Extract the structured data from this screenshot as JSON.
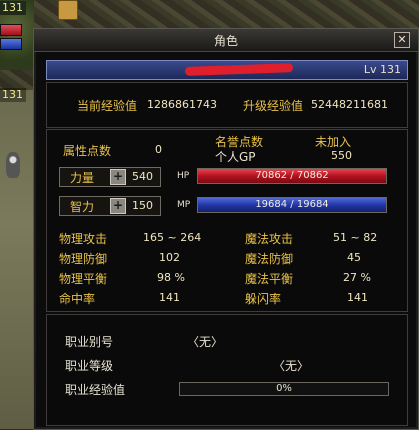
{
  "hud": {
    "top_number": "131",
    "side_number": "131"
  },
  "window": {
    "title": "角色",
    "close_glyph": "✕"
  },
  "character": {
    "level_label": "Lv 131"
  },
  "experience": {
    "current_label": "当前经验值",
    "current_value": "1286861743",
    "next_label": "升级经验值",
    "next_value": "52448211681"
  },
  "points": {
    "attr_label": "属性点数",
    "attr_value": "0",
    "honor_label": "名誉点数",
    "honor_value": "未加入",
    "gp_label": "个人GP",
    "gp_value": "550"
  },
  "strength": {
    "label": "力量",
    "value": "540",
    "bar_tag": "HP",
    "bar_text": "70862 / 70862",
    "fill": 1.0
  },
  "intellect": {
    "label": "智力",
    "value": "150",
    "bar_tag": "MP",
    "bar_text": "19684 / 19684",
    "fill": 1.0
  },
  "stats": {
    "phys_atk_label": "物理攻击",
    "phys_atk_value": "165 ~ 264",
    "mag_atk_label": "魔法攻击",
    "mag_atk_value": "51 ~ 82",
    "phys_def_label": "物理防御",
    "phys_def_value": "102",
    "mag_def_label": "魔法防御",
    "mag_def_value": "45",
    "phys_bal_label": "物理平衡",
    "phys_bal_value": "98 %",
    "mag_bal_label": "魔法平衡",
    "mag_bal_value": "27 %",
    "hit_label": "命中率",
    "hit_value": "141",
    "dodge_label": "躲闪率",
    "dodge_value": "141"
  },
  "job": {
    "alias_label": "职业别号",
    "alias_value": "〈无〉",
    "level_label": "职业等级",
    "level_value": "〈无〉",
    "exp_label": "职业经验值",
    "exp_value": "0%",
    "exp_fill": 0
  },
  "colors": {
    "label_gold": "#e9c24a",
    "hp_red": "#b3131f",
    "mp_blue": "#2236a8",
    "namebar_blue": "#2b3a78"
  }
}
